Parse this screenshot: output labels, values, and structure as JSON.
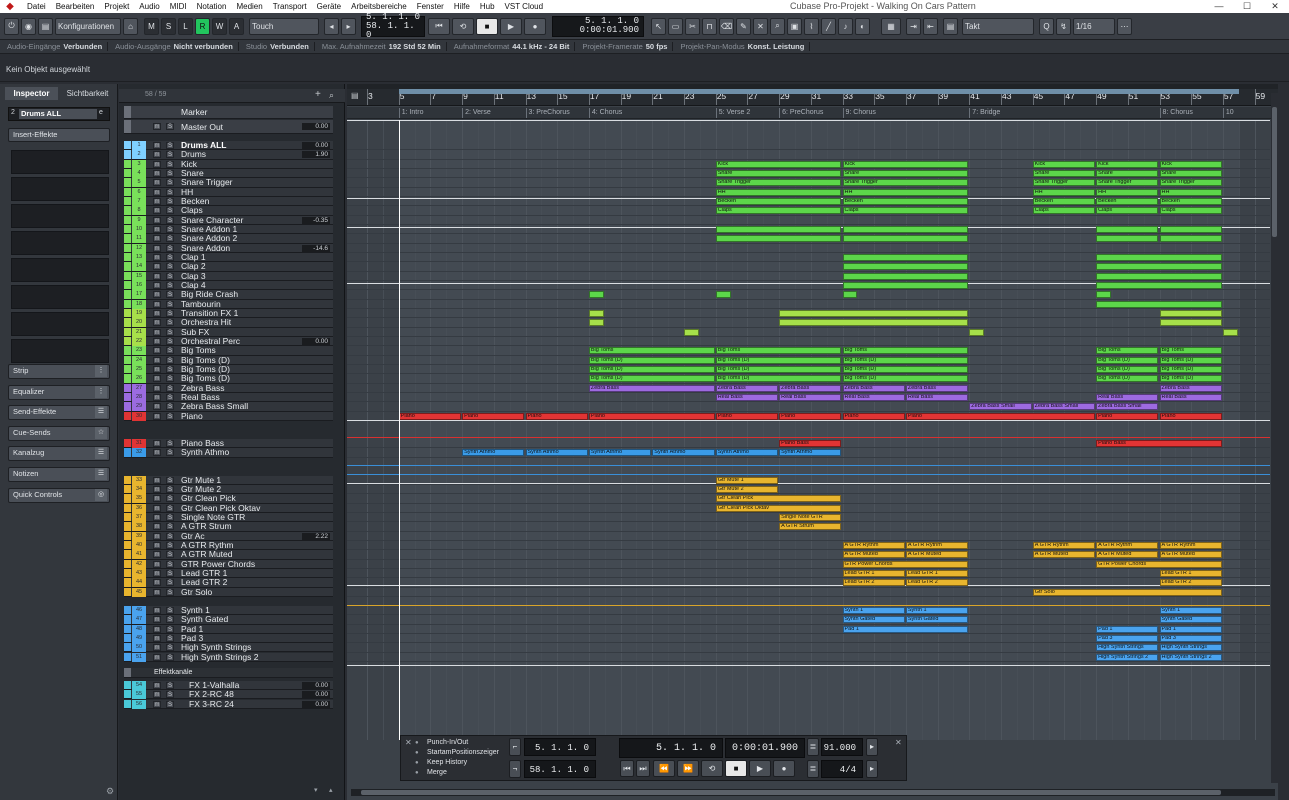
{
  "menubar": {
    "items": [
      "Datei",
      "Bearbeiten",
      "Projekt",
      "Audio",
      "MIDI",
      "Notation",
      "Medien",
      "Transport",
      "Geräte",
      "Arbeitsbereiche",
      "Fenster",
      "Hilfe",
      "Hub",
      "VST Cloud"
    ],
    "title": "Cubase Pro-Projekt - Walking On Cars Pattern"
  },
  "toolbar": {
    "config": "Konfigurationen",
    "m": "M",
    "s": "S",
    "l": "L",
    "r": "R",
    "w": "W",
    "a": "A",
    "touch": "Touch",
    "pos1": "5. 1. 1. 0",
    "pos2": "58. 1. 1. 0",
    "pos3": "0:00:01.900",
    "main_pos": "5. 1. 1. 0",
    "main_time": "0:00:01.900",
    "snap": "Takt",
    "quant": "1/16"
  },
  "status": [
    {
      "label": "Audio-Eingänge",
      "value": "Verbunden"
    },
    {
      "label": "Audio-Ausgänge",
      "value": "Nicht verbunden"
    },
    {
      "label": "Studio",
      "value": "Verbunden"
    },
    {
      "label": "Max. Aufnahmezeit",
      "value": "192 Std 52 Min"
    },
    {
      "label": "Aufnahmeformat",
      "value": "44.1 kHz - 24 Bit"
    },
    {
      "label": "Projekt-Framerate",
      "value": "50 fps"
    },
    {
      "label": "Projekt-Pan-Modus",
      "value": "Konst. Leistung"
    }
  ],
  "infoline": "Kein Objekt ausgewählt",
  "inspector": {
    "tab1": "Inspector",
    "tab2": "Sichtbarkeit",
    "track": "Drums ALL",
    "inserts": "Insert-Effekte",
    "sections": [
      "Strip",
      "Equalizer",
      "Send-Effekte",
      "Cue-Sends",
      "Kanalzug",
      "Notizen",
      "Quick Controls"
    ]
  },
  "tracklist": {
    "count": "58 / 59",
    "marker": "Marker",
    "master": "Master Out",
    "master_val": "0.00",
    "tracks": [
      {
        "n": "1",
        "name": "Drums ALL",
        "val": "0.00",
        "c": "#7fd0ff"
      },
      {
        "n": "2",
        "name": "Drums",
        "val": "1.90",
        "c": "#7fd0ff"
      },
      {
        "n": "3",
        "name": "Kick",
        "val": "",
        "c": "#79e05a"
      },
      {
        "n": "4",
        "name": "Snare",
        "val": "",
        "c": "#79e05a"
      },
      {
        "n": "5",
        "name": "Snare Trigger",
        "val": "",
        "c": "#79e05a"
      },
      {
        "n": "6",
        "name": "HH",
        "val": "",
        "c": "#79e05a"
      },
      {
        "n": "7",
        "name": "Becken",
        "val": "",
        "c": "#79e05a"
      },
      {
        "n": "8",
        "name": "Claps",
        "val": "",
        "c": "#79e05a"
      },
      {
        "n": "9",
        "name": "Snare Character",
        "val": "-0.35",
        "c": "#79e05a"
      },
      {
        "n": "10",
        "name": "Snare Addon 1",
        "val": "",
        "c": "#79e05a"
      },
      {
        "n": "11",
        "name": "Snare Addon 2",
        "val": "",
        "c": "#79e05a"
      },
      {
        "n": "12",
        "name": "Snare Addon",
        "val": "-14.6",
        "c": "#79e05a"
      },
      {
        "n": "13",
        "name": "Clap 1",
        "val": "",
        "c": "#79e05a"
      },
      {
        "n": "14",
        "name": "Clap 2",
        "val": "",
        "c": "#79e05a"
      },
      {
        "n": "15",
        "name": "Clap 3",
        "val": "",
        "c": "#79e05a"
      },
      {
        "n": "16",
        "name": "Clap 4",
        "val": "",
        "c": "#79e05a"
      },
      {
        "n": "17",
        "name": "Big Ride Crash",
        "val": "",
        "c": "#79e05a"
      },
      {
        "n": "18",
        "name": "Tambourin",
        "val": "",
        "c": "#79e05a"
      },
      {
        "n": "19",
        "name": "Transition FX 1",
        "val": "",
        "c": "#a7e04a"
      },
      {
        "n": "20",
        "name": "Orchestra Hit",
        "val": "",
        "c": "#a7e04a"
      },
      {
        "n": "21",
        "name": "Sub FX",
        "val": "",
        "c": "#a7e04a"
      },
      {
        "n": "22",
        "name": "Orchestral Perc",
        "val": "0.00",
        "c": "#a7e04a"
      },
      {
        "n": "23",
        "name": "Big Toms",
        "val": "",
        "c": "#79e05a"
      },
      {
        "n": "24",
        "name": "Big Toms (D)",
        "val": "",
        "c": "#79e05a"
      },
      {
        "n": "25",
        "name": "Big Toms (D)",
        "val": "",
        "c": "#79e05a"
      },
      {
        "n": "26",
        "name": "Big Toms (D)",
        "val": "",
        "c": "#79e05a"
      },
      {
        "n": "27",
        "name": "Zebra Bass",
        "val": "",
        "c": "#9b6be0"
      },
      {
        "n": "28",
        "name": "Real Bass",
        "val": "",
        "c": "#9b6be0"
      },
      {
        "n": "29",
        "name": "Zebra Bass Small",
        "val": "",
        "c": "#9b6be0"
      },
      {
        "n": "30",
        "name": "Piano",
        "val": "",
        "c": "#e03434"
      },
      {
        "n": "31",
        "name": "Piano Bass",
        "val": "",
        "c": "#e03434"
      },
      {
        "n": "32",
        "name": "Synth Athmo",
        "val": "",
        "c": "#3a9be8"
      },
      {
        "n": "33",
        "name": "Gtr Mute 1",
        "val": "",
        "c": "#e8b52e"
      },
      {
        "n": "34",
        "name": "Gtr Mute 2",
        "val": "",
        "c": "#e8b52e"
      },
      {
        "n": "35",
        "name": "Gtr Clean Pick",
        "val": "",
        "c": "#e8b52e"
      },
      {
        "n": "36",
        "name": "Gtr Clean Pick Oktav",
        "val": "",
        "c": "#e8b52e"
      },
      {
        "n": "37",
        "name": "Single Note GTR",
        "val": "",
        "c": "#e8b52e"
      },
      {
        "n": "38",
        "name": "A GTR Strum",
        "val": "",
        "c": "#e8b52e"
      },
      {
        "n": "39",
        "name": "Gtr Ac",
        "val": "2.22",
        "c": "#e8b52e"
      },
      {
        "n": "40",
        "name": "A GTR Rythm",
        "val": "",
        "c": "#e8b52e"
      },
      {
        "n": "41",
        "name": "A GTR Muted",
        "val": "",
        "c": "#e8b52e"
      },
      {
        "n": "42",
        "name": "GTR Power Chords",
        "val": "",
        "c": "#e8b52e"
      },
      {
        "n": "43",
        "name": "Lead GTR 1",
        "val": "",
        "c": "#e8b52e"
      },
      {
        "n": "44",
        "name": "Lead GTR 2",
        "val": "",
        "c": "#e8b52e"
      },
      {
        "n": "45",
        "name": "Gtr Solo",
        "val": "",
        "c": "#e8b52e"
      },
      {
        "n": "46",
        "name": "Synth 1",
        "val": "",
        "c": "#4aa3ee"
      },
      {
        "n": "47",
        "name": "Synth Gated",
        "val": "",
        "c": "#4aa3ee"
      },
      {
        "n": "48",
        "name": "Pad 1",
        "val": "",
        "c": "#4aa3ee"
      },
      {
        "n": "49",
        "name": "Pad 3",
        "val": "",
        "c": "#4aa3ee"
      },
      {
        "n": "50",
        "name": "High Synth Strings",
        "val": "",
        "c": "#4aa3ee"
      },
      {
        "n": "51",
        "name": "High Synth Strings 2",
        "val": "",
        "c": "#4aa3ee"
      }
    ],
    "fx_folder": "Effektkanäle",
    "fx": [
      {
        "n": "54",
        "name": "FX 1-Valhalla",
        "val": "0.00"
      },
      {
        "n": "55",
        "name": "FX 2-RC 48",
        "val": "0.00"
      },
      {
        "n": "56",
        "name": "FX 3-RC 24",
        "val": "0.00"
      }
    ]
  },
  "ruler": [
    "3",
    "5",
    "7",
    "9",
    "11",
    "13",
    "15",
    "17",
    "19",
    "21",
    "23",
    "25",
    "27",
    "29",
    "31",
    "33",
    "35",
    "37",
    "39",
    "41",
    "43",
    "45",
    "47",
    "49",
    "51",
    "53",
    "55",
    "57",
    "59"
  ],
  "markers": [
    {
      "bar": 5,
      "label": "1: Intro"
    },
    {
      "bar": 9,
      "label": "2: Verse"
    },
    {
      "bar": 13,
      "label": "3: PreChorus"
    },
    {
      "bar": 17,
      "label": "4: Chorus"
    },
    {
      "bar": 25,
      "label": "5: Verse 2"
    },
    {
      "bar": 29,
      "label": "6: PreChorus"
    },
    {
      "bar": 33,
      "label": "9: Chorus"
    },
    {
      "bar": 41,
      "label": "7: Bridge"
    },
    {
      "bar": 53,
      "label": "8: Chorus"
    },
    {
      "bar": 57,
      "label": "10"
    }
  ],
  "transport": {
    "presets": [
      "Punch-In/Out",
      "StartamPositionszeiger",
      "Keep History",
      "Merge"
    ],
    "left": "5. 1. 1. 0",
    "right": "58. 1. 1. 0",
    "pos": "5. 1. 1. 0",
    "time": "0:00:01.900",
    "tempo": "91.000",
    "sig": "4/4"
  }
}
